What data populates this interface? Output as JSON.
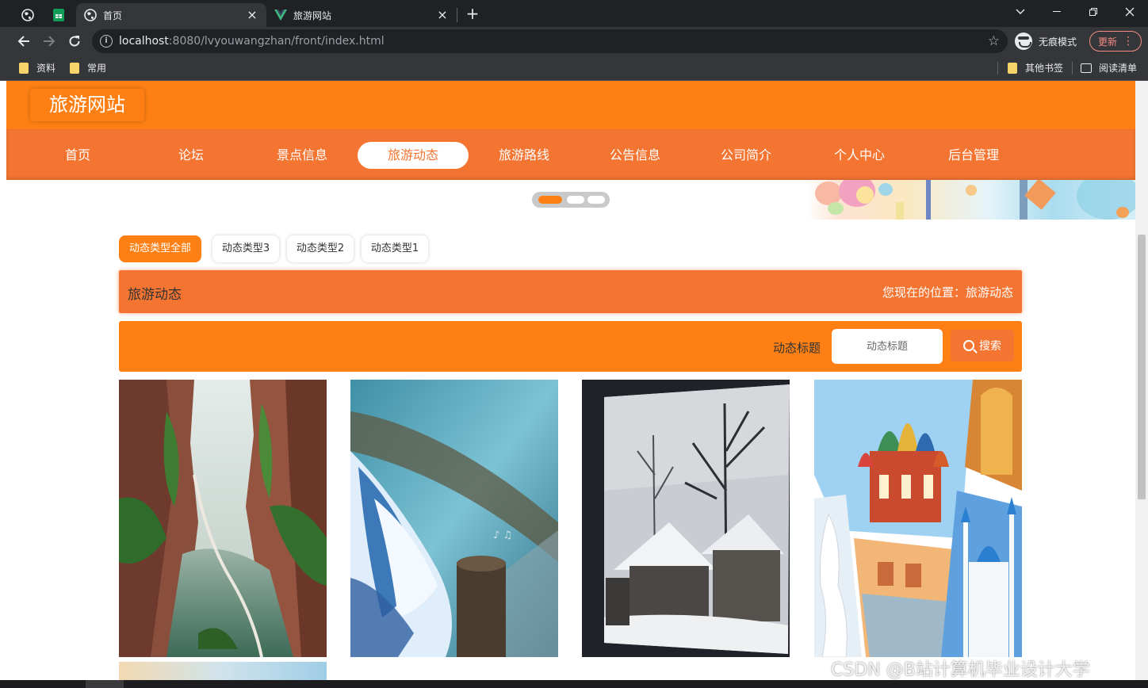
{
  "browser": {
    "tabs": [
      {
        "title": "首页",
        "active": true
      },
      {
        "title": "旅游网站",
        "active": false
      }
    ],
    "url_host": "localhost",
    "url_rest": ":8080/lvyouwangzhan/front/index.html",
    "incognito_label": "无痕模式",
    "update_label": "更新",
    "bookmarks": {
      "left": [
        "资料",
        "常用"
      ],
      "other": "其他书签",
      "reading_list": "阅读清单"
    }
  },
  "site": {
    "logo": "旅游网站",
    "nav": [
      "首页",
      "论坛",
      "景点信息",
      "旅游动态",
      "旅游路线",
      "公告信息",
      "公司简介",
      "个人中心",
      "后台管理"
    ],
    "active_nav": "旅游动态"
  },
  "filters": [
    "动态类型全部",
    "动态类型3",
    "动态类型2",
    "动态类型1"
  ],
  "title_bar": {
    "title": "旅游动态",
    "breadcrumb": "您现在的位置：旅游动态"
  },
  "search": {
    "label": "动态标题",
    "placeholder": "动态标题",
    "button": "搜索"
  },
  "cards": [
    {
      "image": "canyon-river-photo"
    },
    {
      "image": "waterfall-photo"
    },
    {
      "image": "snowy-village-photo"
    },
    {
      "image": "russia-collage-photo"
    }
  ],
  "watermark": "CSDN @B站计算机毕业设计大学",
  "colors": {
    "header_orange": "#fe8014",
    "nav_orange": "#f47532"
  }
}
